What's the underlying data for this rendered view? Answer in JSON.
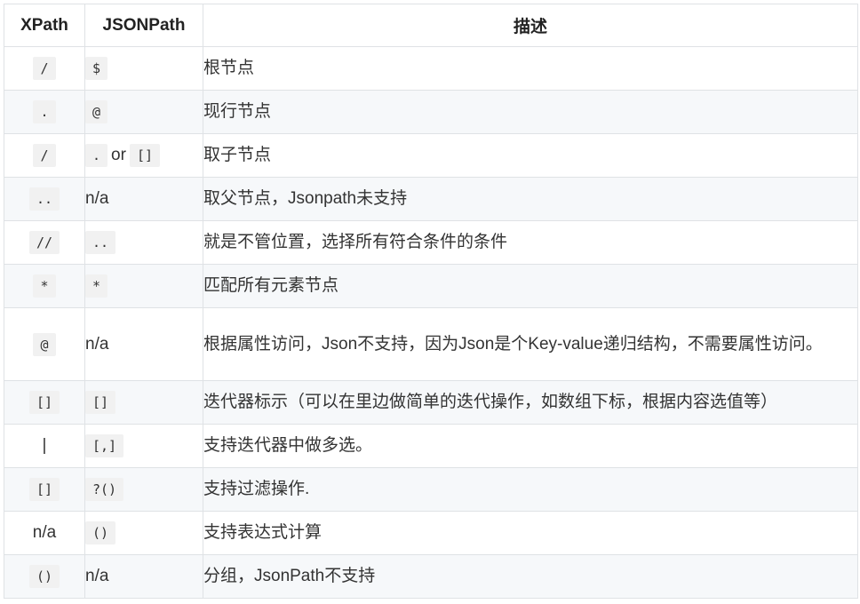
{
  "headers": [
    "XPath",
    "JSONPath",
    "描述"
  ],
  "rows": [
    {
      "xpath": "/",
      "xpath_code": true,
      "jsonpath": "$",
      "jsonpath_code": true,
      "desc": "根节点"
    },
    {
      "xpath": ".",
      "xpath_code": true,
      "jsonpath": "@",
      "jsonpath_code": true,
      "desc": "现行节点"
    },
    {
      "xpath": "/",
      "xpath_code": true,
      "jsonpath_parts": [
        ".",
        "or",
        "[]"
      ],
      "desc": "取子节点"
    },
    {
      "xpath": "..",
      "xpath_code": true,
      "jsonpath": "n/a",
      "jsonpath_code": false,
      "desc": "取父节点，Jsonpath未支持"
    },
    {
      "xpath": "//",
      "xpath_code": true,
      "jsonpath": "..",
      "jsonpath_code": true,
      "desc": "就是不管位置，选择所有符合条件的条件"
    },
    {
      "xpath": "*",
      "xpath_code": true,
      "jsonpath": "*",
      "jsonpath_code": true,
      "desc": "匹配所有元素节点"
    },
    {
      "xpath": "@",
      "xpath_code": true,
      "jsonpath": "n/a",
      "jsonpath_code": false,
      "desc": "根据属性访问，Json不支持，因为Json是个Key-value递归结构，不需要属性访问。"
    },
    {
      "xpath": "[]",
      "xpath_code": true,
      "jsonpath": "[]",
      "jsonpath_code": true,
      "desc": "迭代器标示（可以在里边做简单的迭代操作，如数组下标，根据内容选值等）"
    },
    {
      "xpath": "|",
      "xpath_code": false,
      "jsonpath": "[,]",
      "jsonpath_code": true,
      "desc": "支持迭代器中做多选。"
    },
    {
      "xpath": "[]",
      "xpath_code": true,
      "jsonpath": "?()",
      "jsonpath_code": true,
      "desc": "支持过滤操作."
    },
    {
      "xpath": "n/a",
      "xpath_code": false,
      "jsonpath": "()",
      "jsonpath_code": true,
      "desc": "支持表达式计算"
    },
    {
      "xpath": "()",
      "xpath_code": true,
      "jsonpath": "n/a",
      "jsonpath_code": false,
      "desc": "分组，JsonPath不支持"
    }
  ]
}
